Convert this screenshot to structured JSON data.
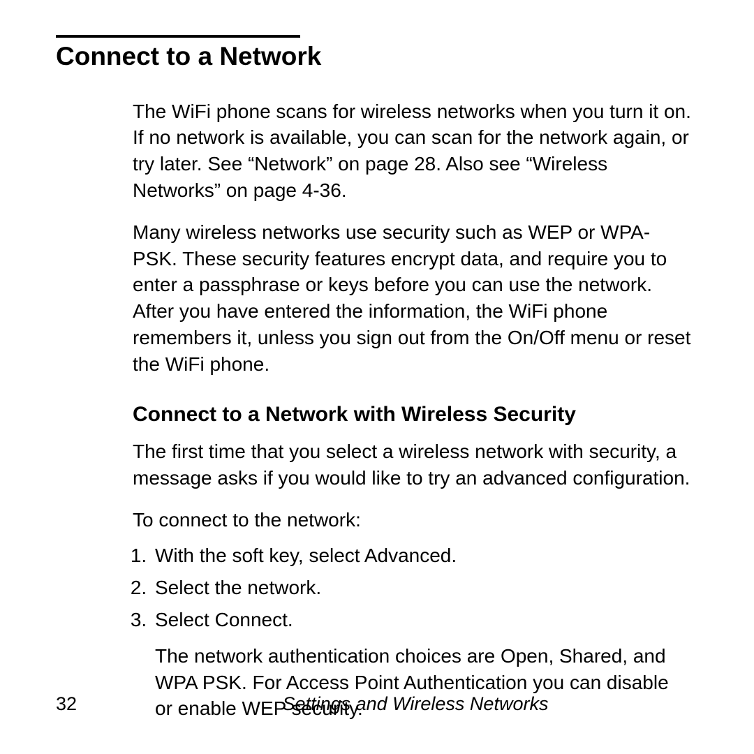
{
  "heading": "Connect to a Network",
  "paragraphs": {
    "p1": "The WiFi phone scans for wireless networks when you turn it on. If no network is available, you can scan for the network again, or try later. See “Network” on page 28. Also see “Wireless Networks” on page 4-36.",
    "p2": "Many wireless networks use security such as WEP or WPA-PSK. These security features encrypt data, and require you to enter a passphrase or keys before you can use the network. After you have entered the information, the WiFi phone remembers it, unless you sign out from the On/Off menu or reset the WiFi phone."
  },
  "subheading": "Connect to a Network with Wireless Security",
  "sub_para": "The first time that you select a wireless network with security, a message asks if you would like to try an advanced configuration.",
  "list_lead": "To connect to the network:",
  "steps": [
    "With the soft key, select Advanced.",
    "Select the network.",
    "Select Connect."
  ],
  "step_note": "The network authentication choices are Open, Shared, and WPA PSK. For Access Point Authentication you can disable or enable WEP security.",
  "footer": {
    "page_number": "32",
    "chapter_title": "Settings and Wireless Networks"
  }
}
